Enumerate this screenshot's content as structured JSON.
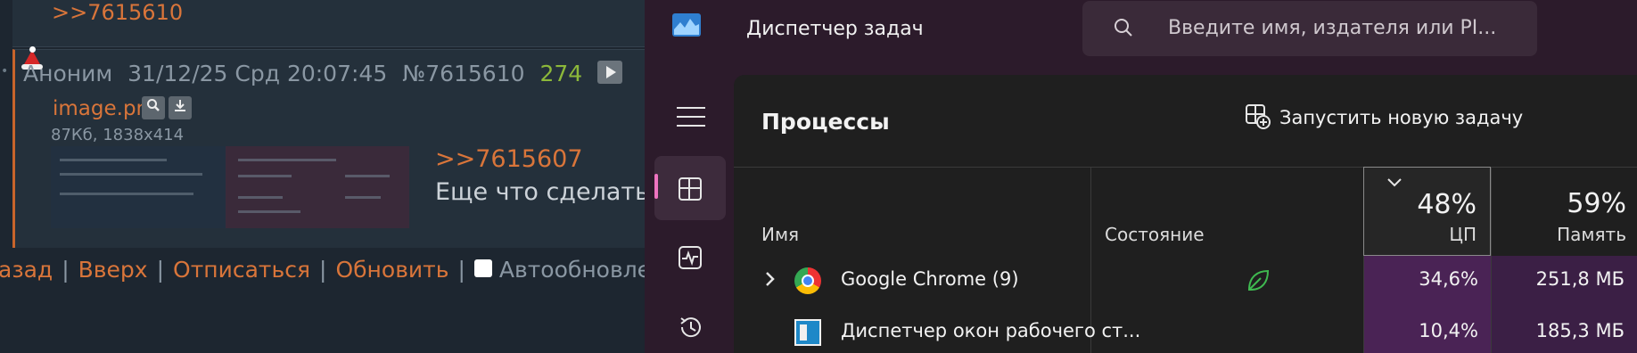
{
  "forum": {
    "prev_reply_link": ">>7615610",
    "post": {
      "author": "Аноним",
      "date": "31/12/25 Срд 20:07:45",
      "number": "№7615610",
      "likes": "274",
      "file_name": "image.png",
      "file_meta": "87Кб, 1838x414",
      "reply_link": ">>7615607",
      "text": "Еще что сделать?"
    },
    "nav": {
      "back": "азад",
      "top": "Вверх",
      "unsubscribe": "Отписаться",
      "refresh": "Обновить",
      "autoupdate": "Автообновление"
    }
  },
  "task_manager": {
    "title": "Диспетчер задач",
    "search_placeholder": "Введите имя, издателя или PI...",
    "section_title": "Процессы",
    "run_task_label": "Запустить новую задачу",
    "columns": {
      "name": "Имя",
      "state": "Состояние",
      "cpu_total": "48%",
      "cpu_label": "ЦП",
      "mem_total": "59%",
      "mem_label": "Память"
    },
    "rows": [
      {
        "name": "Google Chrome (9)",
        "cpu": "34,6%",
        "mem": "251,8 МБ",
        "icon": "chrome-icon"
      },
      {
        "name": "Диспетчер окон рабочего ст...",
        "cpu": "10,4%",
        "mem": "185,3 МБ",
        "icon": "dwm-icon"
      }
    ],
    "colors": {
      "accent": "#ee74c0",
      "cpu_heat": "#4a2355",
      "mem_heat": "#3b1f45"
    }
  }
}
